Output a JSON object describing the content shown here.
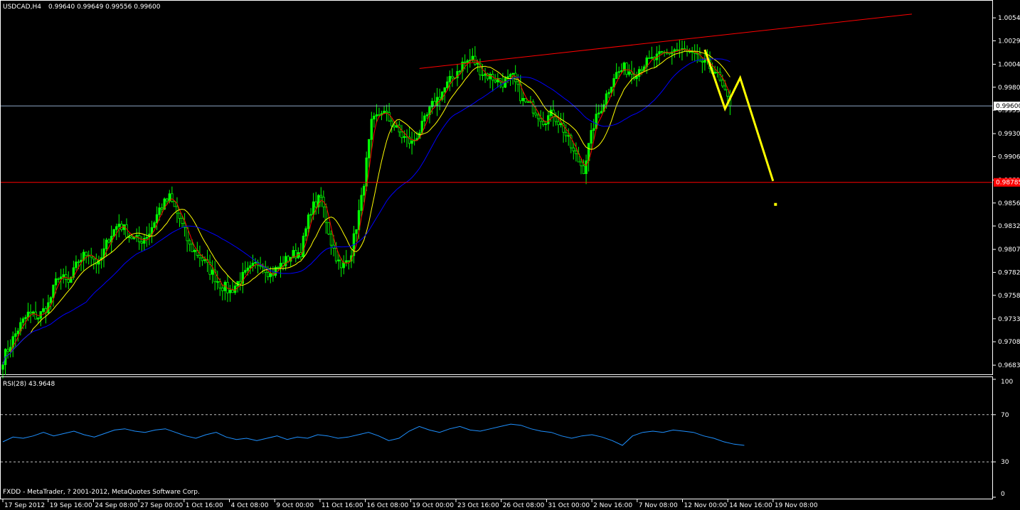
{
  "header": {
    "symbol_label": "USDCAD,H4",
    "ohlc": "0.99640 0.99649 0.99556 0.99600"
  },
  "rsi_panel": {
    "label": "RSI(28) 43.9648"
  },
  "footer": {
    "copyright": "FXDD - MetaTrader, ? 2001-2012, MetaQuotes Software Corp."
  },
  "colors": {
    "background": "#000000",
    "candle": "#00ff00",
    "ma_fast": "#ff0000",
    "ma_mid": "#ffff00",
    "ma_slow": "#0000ff",
    "rsi": "#1e90ff",
    "trendline": "#ff0000",
    "support_line": "#ff0000",
    "price_line": "#8fa8c8",
    "projection": "#ffff00",
    "axis": "#ffffff",
    "level_dash": "#c0c0c0",
    "support_tag": "#ff0000",
    "price_tag": "#ffffff"
  },
  "chart_data": {
    "type": "candlestick",
    "title": "USDCAD,H4",
    "x_tick_labels": [
      "17 Sep 2012",
      "19 Sep 16:00",
      "24 Sep 08:00",
      "27 Sep 00:00",
      "1 Oct 16:00",
      "4 Oct 08:00",
      "9 Oct 00:00",
      "11 Oct 16:00",
      "16 Oct 08:00",
      "19 Oct 00:00",
      "23 Oct 16:00",
      "26 Oct 08:00",
      "31 Oct 00:00",
      "2 Nov 16:00",
      "7 Nov 08:00",
      "12 Nov 00:00",
      "14 Nov 16:00",
      "19 Nov 08:00"
    ],
    "y_tick_labels": [
      "1.00540",
      "1.00295",
      "1.00045",
      "0.99800",
      "0.99555",
      "0.99305",
      "0.99060",
      "0.98810",
      "0.98565",
      "0.98320",
      "0.98070",
      "0.97825",
      "0.97580",
      "0.97330",
      "0.97085",
      "0.96835"
    ],
    "ylim": [
      0.9676,
      1.007
    ],
    "price_levels": {
      "current": "0.99600",
      "support": "0.98785"
    },
    "close_path": [
      [
        0,
        0.969
      ],
      [
        6,
        0.9722
      ],
      [
        10,
        0.9738
      ],
      [
        14,
        0.9735
      ],
      [
        18,
        0.9748
      ],
      [
        22,
        0.978
      ],
      [
        26,
        0.977
      ],
      [
        30,
        0.9795
      ],
      [
        34,
        0.9805
      ],
      [
        38,
        0.979
      ],
      [
        42,
        0.982
      ],
      [
        46,
        0.9835
      ],
      [
        50,
        0.9822
      ],
      [
        54,
        0.9815
      ],
      [
        58,
        0.9825
      ],
      [
        62,
        0.985
      ],
      [
        66,
        0.9862
      ],
      [
        70,
        0.984
      ],
      [
        74,
        0.981
      ],
      [
        78,
        0.98
      ],
      [
        82,
        0.9785
      ],
      [
        86,
        0.977
      ],
      [
        90,
        0.9762
      ],
      [
        94,
        0.9775
      ],
      [
        98,
        0.9785
      ],
      [
        102,
        0.9795
      ],
      [
        106,
        0.978
      ],
      [
        110,
        0.979
      ],
      [
        114,
        0.98
      ],
      [
        118,
        0.9805
      ],
      [
        122,
        0.985
      ],
      [
        126,
        0.9862
      ],
      [
        130,
        0.9815
      ],
      [
        134,
        0.9785
      ],
      [
        138,
        0.9805
      ],
      [
        142,
        0.986
      ],
      [
        146,
        0.994
      ],
      [
        150,
        0.9955
      ],
      [
        154,
        0.9942
      ],
      [
        158,
        0.9928
      ],
      [
        162,
        0.992
      ],
      [
        166,
        0.9938
      ],
      [
        170,
        0.996
      ],
      [
        174,
        0.9975
      ],
      [
        178,
        0.999
      ],
      [
        182,
        1.0005
      ],
      [
        186,
        1.001
      ],
      [
        190,
        0.9995
      ],
      [
        194,
        0.999
      ],
      [
        198,
        0.9985
      ],
      [
        202,
        0.999
      ],
      [
        206,
        0.9965
      ],
      [
        210,
        0.9958
      ],
      [
        214,
        0.9945
      ],
      [
        218,
        0.9952
      ],
      [
        222,
        0.9935
      ],
      [
        226,
        0.991
      ],
      [
        230,
        0.9893
      ],
      [
        234,
        0.994
      ],
      [
        238,
        0.9965
      ],
      [
        242,
        0.9992
      ],
      [
        246,
        1.0
      ],
      [
        250,
        0.9995
      ],
      [
        254,
        1.0005
      ],
      [
        258,
        1.001
      ],
      [
        262,
        1.0015
      ],
      [
        266,
        1.002
      ],
      [
        270,
        1.0018
      ],
      [
        274,
        1.0012
      ],
      [
        278,
        1.0005
      ],
      [
        282,
        0.9998
      ],
      [
        286,
        0.9972
      ],
      [
        288,
        0.9962
      ]
    ],
    "moving_averages": [
      {
        "color": "ma_fast",
        "period": 4
      },
      {
        "color": "ma_mid",
        "period": 12
      },
      {
        "color": "ma_slow",
        "period": 34
      }
    ],
    "trendline": {
      "from": [
        165,
        1.0
      ],
      "to": [
        360,
        1.0058
      ]
    },
    "projection": [
      [
        278,
        1.002
      ],
      [
        286,
        0.9957
      ],
      [
        292,
        0.999
      ],
      [
        305,
        0.988
      ]
    ],
    "projection_dot": [
      306,
      0.9855
    ],
    "rsi": {
      "name": "RSI(28)",
      "value": 43.9648,
      "ylim": [
        0,
        100
      ],
      "y_tick_labels": [
        "100",
        "70",
        "30",
        "0"
      ],
      "levels": [
        70,
        30
      ],
      "values": [
        47,
        51,
        50,
        52,
        55,
        52,
        54,
        56,
        53,
        51,
        54,
        57,
        58,
        56,
        55,
        57,
        58,
        55,
        52,
        50,
        53,
        55,
        51,
        49,
        50,
        48,
        50,
        52,
        49,
        51,
        50,
        53,
        52,
        50,
        51,
        53,
        55,
        52,
        48,
        50,
        56,
        60,
        57,
        55,
        58,
        60,
        57,
        56,
        58,
        60,
        62,
        61,
        58,
        56,
        55,
        52,
        50,
        52,
        53,
        51,
        48,
        44,
        52,
        55,
        56,
        55,
        57,
        56,
        55,
        52,
        50,
        47,
        45,
        44
      ]
    }
  }
}
